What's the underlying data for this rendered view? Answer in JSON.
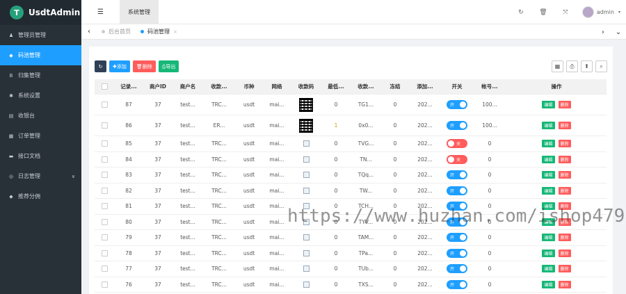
{
  "app": {
    "logo_letter": "T",
    "name": "UsdtAdmin",
    "brand_color": "#26a17b",
    "accent": "#1e9fff"
  },
  "sidebar": {
    "items": [
      {
        "label": "管理员管理",
        "icon": "user-icon",
        "glyph": "♟"
      },
      {
        "label": "码池管理",
        "icon": "pool-icon",
        "glyph": "◆",
        "active": true
      },
      {
        "label": "归集管理",
        "icon": "bitcoin-icon",
        "glyph": "B"
      },
      {
        "label": "系统设置",
        "icon": "gear-icon",
        "glyph": "✱"
      },
      {
        "label": "收银台",
        "icon": "cashier-icon",
        "glyph": "▤"
      },
      {
        "label": "订单管理",
        "icon": "calculator-icon",
        "glyph": "▦"
      },
      {
        "label": "接口文档",
        "icon": "document-icon",
        "glyph": "▬"
      },
      {
        "label": "日志管理",
        "icon": "log-icon",
        "glyph": "◎",
        "chevron": "∨"
      },
      {
        "label": "推荐分佣",
        "icon": "share-icon",
        "glyph": "◆"
      }
    ]
  },
  "topbar": {
    "menu_icon": "☰",
    "tab": "系统管理",
    "icons": {
      "refresh": "↻",
      "trash": "🗑",
      "fullscreen": "⤧"
    },
    "user": "admin",
    "caret": "▾"
  },
  "tabs": {
    "left_arrow": "‹",
    "right_arrow": "›",
    "chevron_down": "⌄",
    "items": [
      {
        "label": "后台首页",
        "active": false
      },
      {
        "label": "码池管理",
        "active": true,
        "close": "×"
      }
    ]
  },
  "toolbar": {
    "refresh_icon": "↻",
    "add": "✚添加",
    "delete": "🗑删除",
    "export": "⎙导出",
    "right_icons": [
      "▦",
      "⎙",
      "⬆",
      "⌕"
    ]
  },
  "table": {
    "columns": [
      "",
      "记录...",
      "商户ID",
      "商户名",
      "收款...",
      "币种",
      "网络",
      "收款码",
      "最低...",
      "收款...",
      "冻结",
      "添加...",
      "开关",
      "帐号...",
      "操作"
    ],
    "switch_on": "开",
    "switch_off": "关",
    "edit_label": "编辑",
    "delete_label": "删除",
    "rows": [
      {
        "id": "87",
        "mid": "37",
        "mname": "test...",
        "recv": "TRC...",
        "coin": "usdt",
        "net": "mai...",
        "code": "qr",
        "min": "0",
        "addr": "TG1...",
        "frozen": "0",
        "added": "202...",
        "switch": "on",
        "account": "100..."
      },
      {
        "id": "86",
        "mid": "37",
        "mname": "test...",
        "recv": "ER...",
        "coin": "usdt",
        "net": "mai...",
        "code": "qr",
        "min": "1",
        "addr": "0x0...",
        "frozen": "0",
        "added": "202...",
        "switch": "on",
        "account": "100..."
      },
      {
        "id": "85",
        "mid": "37",
        "mname": "test...",
        "recv": "TRC...",
        "coin": "usdt",
        "net": "mai...",
        "code": "img",
        "min": "0",
        "addr": "TVG...",
        "frozen": "0",
        "added": "202...",
        "switch": "off",
        "account": "0"
      },
      {
        "id": "84",
        "mid": "37",
        "mname": "test...",
        "recv": "TRC...",
        "coin": "usdt",
        "net": "mai...",
        "code": "img",
        "min": "0",
        "addr": "TN...",
        "frozen": "0",
        "added": "202...",
        "switch": "off",
        "account": "0"
      },
      {
        "id": "83",
        "mid": "37",
        "mname": "test...",
        "recv": "TRC...",
        "coin": "usdt",
        "net": "mai...",
        "code": "img",
        "min": "0",
        "addr": "TQq...",
        "frozen": "0",
        "added": "202...",
        "switch": "on",
        "account": "0"
      },
      {
        "id": "82",
        "mid": "37",
        "mname": "test...",
        "recv": "TRC...",
        "coin": "usdt",
        "net": "mai...",
        "code": "img",
        "min": "0",
        "addr": "TW...",
        "frozen": "0",
        "added": "202...",
        "switch": "on",
        "account": "0"
      },
      {
        "id": "81",
        "mid": "37",
        "mname": "test...",
        "recv": "TRC...",
        "coin": "usdt",
        "net": "mai...",
        "code": "img",
        "min": "0",
        "addr": "TCH...",
        "frozen": "0",
        "added": "202...",
        "switch": "on",
        "account": "0"
      },
      {
        "id": "80",
        "mid": "37",
        "mname": "test...",
        "recv": "TRC...",
        "coin": "usdt",
        "net": "mai...",
        "code": "img",
        "min": "0",
        "addr": "TYV...",
        "frozen": "0",
        "added": "202...",
        "switch": "on",
        "account": "0"
      },
      {
        "id": "79",
        "mid": "37",
        "mname": "test...",
        "recv": "TRC...",
        "coin": "usdt",
        "net": "mai...",
        "code": "img",
        "min": "0",
        "addr": "TAM...",
        "frozen": "0",
        "added": "202...",
        "switch": "on",
        "account": "0"
      },
      {
        "id": "78",
        "mid": "37",
        "mname": "test...",
        "recv": "TRC...",
        "coin": "usdt",
        "net": "mai...",
        "code": "img",
        "min": "0",
        "addr": "TPa...",
        "frozen": "0",
        "added": "202...",
        "switch": "on",
        "account": "0"
      },
      {
        "id": "77",
        "mid": "37",
        "mname": "test...",
        "recv": "TRC...",
        "coin": "usdt",
        "net": "mai...",
        "code": "img",
        "min": "0",
        "addr": "TUb...",
        "frozen": "0",
        "added": "202...",
        "switch": "on",
        "account": "0"
      },
      {
        "id": "76",
        "mid": "37",
        "mname": "test...",
        "recv": "TRC...",
        "coin": "usdt",
        "net": "mai...",
        "code": "img",
        "min": "0",
        "addr": "TXS...",
        "frozen": "0",
        "added": "202...",
        "switch": "on",
        "account": "0"
      }
    ]
  },
  "watermark": "https://www.huzhan.com/ishop47988"
}
